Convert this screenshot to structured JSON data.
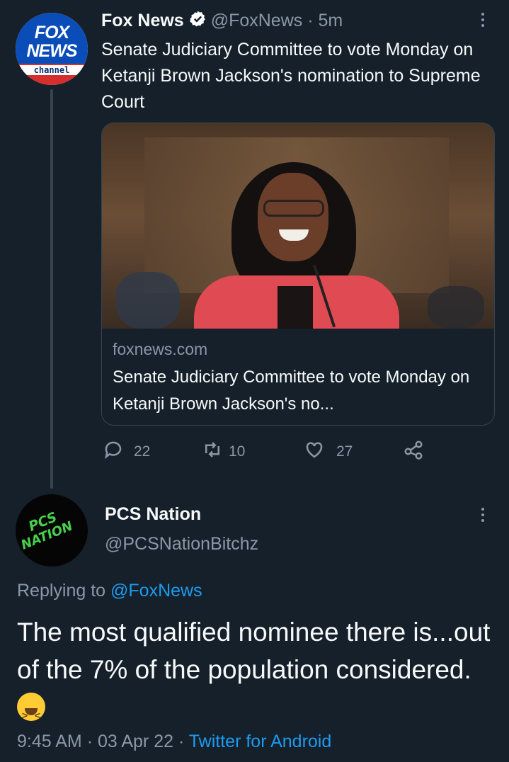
{
  "tweet": {
    "author_name": "Fox News",
    "author_handle": "@FoxNews",
    "time": "5m",
    "avatar": {
      "line1": "FOX",
      "line2": "NEWS",
      "line3": "channel"
    },
    "text": "Senate Judiciary Committee to vote Monday on Ketanji Brown Jackson's nomination to Supreme Court",
    "card": {
      "domain": "foxnews.com",
      "title": "Senate Judiciary Committee to vote Monday on Ketanji Brown Jackson's no..."
    },
    "actions": {
      "replies": "22",
      "retweets": "10",
      "likes": "27"
    }
  },
  "reply": {
    "author_name": "PCS Nation",
    "author_handle": "@PCSNationBitchz",
    "avatar": {
      "line1": "PCS",
      "line2": "NATION"
    },
    "replying_label": "Replying to",
    "replying_to": "@FoxNews",
    "text": "The most qualified nominee there is...out of the 7% of the population considered.",
    "emoji": "squinting-laughing-face",
    "time": "9:45 AM",
    "date": "03 Apr 22",
    "source": "Twitter for Android"
  },
  "colors": {
    "background": "#15202b",
    "text": "#f7f9f9",
    "secondary": "#8b98a5",
    "link": "#1d9bf0",
    "verified": "#ffffff"
  }
}
